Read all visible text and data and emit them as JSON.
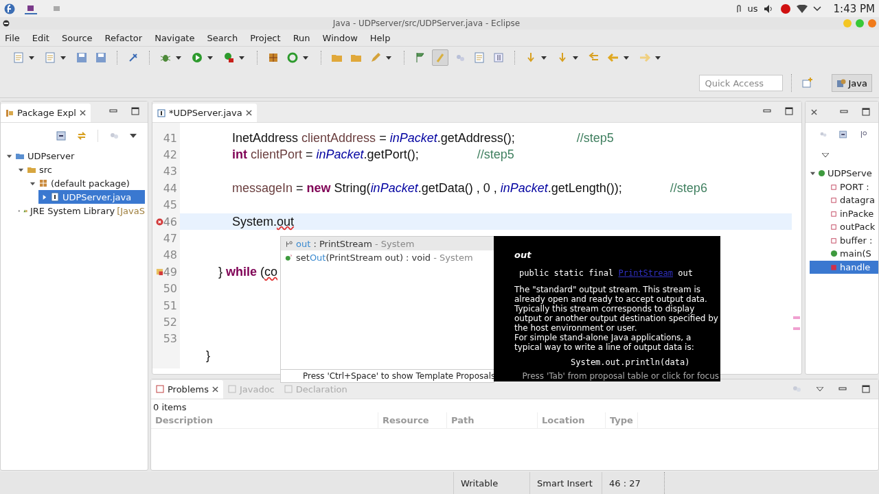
{
  "top_bar": {
    "keyboard": "us",
    "clock": "1:43 PM"
  },
  "window": {
    "title": "Java - UDPserver/src/UDPServer.java - Eclipse"
  },
  "menu": [
    "File",
    "Edit",
    "Source",
    "Refactor",
    "Navigate",
    "Search",
    "Project",
    "Run",
    "Window",
    "Help"
  ],
  "quick_access": {
    "placeholder": "Quick Access"
  },
  "perspective": {
    "label": "Java",
    "selected": true
  },
  "package_explorer": {
    "title": "Package Expl",
    "tree": [
      {
        "label": "UDPserver",
        "kind": "project",
        "expanded": true,
        "selected": false,
        "children": [
          {
            "label": "src",
            "kind": "source-folder",
            "expanded": true,
            "selected": false,
            "children": [
              {
                "label": "(default package)",
                "kind": "package",
                "expanded": true,
                "selected": false,
                "children": [
                  {
                    "label": "UDPServer.java",
                    "kind": "java-file",
                    "expanded": false,
                    "selected": true
                  }
                ]
              }
            ]
          },
          {
            "label": "JRE System Library",
            "decoration": "[JavaS",
            "kind": "library",
            "expanded": false,
            "selected": false
          }
        ]
      }
    ]
  },
  "editor": {
    "tab": {
      "label": "*UDPServer.java",
      "selected": true
    },
    "lines": [
      {
        "number": "41",
        "kind": "statement",
        "current": false,
        "tokens": [
          {
            "kind": "plain",
            "text": "InetAddress "
          },
          {
            "kind": "local",
            "text": "clientAddress"
          },
          {
            "kind": "plain",
            "text": " = "
          },
          {
            "kind": "field",
            "text": "inPacket"
          },
          {
            "kind": "plain",
            "text": ".getAddress();                  "
          },
          {
            "kind": "comment",
            "text": "//step5"
          }
        ]
      },
      {
        "number": "42",
        "kind": "statement",
        "current": false,
        "tokens": [
          {
            "kind": "keyword",
            "text": "int"
          },
          {
            "kind": "local",
            "text": " clientPort"
          },
          {
            "kind": "plain",
            "text": " = "
          },
          {
            "kind": "field",
            "text": "inPacket"
          },
          {
            "kind": "plain",
            "text": ".getPort();                 "
          },
          {
            "kind": "comment",
            "text": "//step5"
          }
        ]
      },
      {
        "number": "43",
        "current": false
      },
      {
        "number": "44",
        "kind": "statement",
        "current": false,
        "tokens": [
          {
            "kind": "local",
            "text": "messageIn"
          },
          {
            "kind": "plain",
            "text": " = "
          },
          {
            "kind": "keyword",
            "text": "new"
          },
          {
            "kind": "plain",
            "text": " String("
          },
          {
            "kind": "field",
            "text": "inPacket"
          },
          {
            "kind": "plain",
            "text": ".getData() , 0 , "
          },
          {
            "kind": "field",
            "text": "inPacket"
          },
          {
            "kind": "plain",
            "text": ".getLength());              "
          },
          {
            "kind": "comment",
            "text": "//step6"
          }
        ]
      },
      {
        "number": "45",
        "current": false
      },
      {
        "number": "46",
        "kind": "statement",
        "current": true,
        "error": true,
        "tokens": [
          {
            "kind": "plain",
            "text": "System."
          },
          {
            "kind": "error",
            "text": "out"
          }
        ]
      },
      {
        "number": "47",
        "current": false
      },
      {
        "number": "48",
        "current": false
      },
      {
        "number": "49",
        "kind": "loop-close",
        "current": false,
        "warning": true,
        "tokens": [
          {
            "kind": "plain",
            "text": "} "
          },
          {
            "kind": "keyword",
            "text": "while"
          },
          {
            "kind": "plain",
            "text": " ("
          },
          {
            "kind": "error",
            "text": "co"
          }
        ]
      },
      {
        "number": "50",
        "current": false
      },
      {
        "number": "51",
        "current": false
      },
      {
        "number": "52",
        "current": false
      },
      {
        "number": "53",
        "current": false
      },
      {
        "kind": "block-close",
        "current": false,
        "tokens": [
          {
            "kind": "plain",
            "text": "}"
          }
        ]
      }
    ]
  },
  "completion": {
    "items": [
      {
        "kind": "field",
        "match": "out",
        "rest": " : PrintStream",
        "qualifier": " - System",
        "selected": true
      },
      {
        "kind": "method",
        "prefix": "set",
        "match": "Out",
        "rest": "(PrintStream out) : void",
        "qualifier": " - System",
        "selected": false
      }
    ],
    "footer": "Press 'Ctrl+Space' to show Template Proposals"
  },
  "javadoc_popup": {
    "name": "out",
    "signature_before": "public static final ",
    "signature_link": "PrintStream",
    "signature_after": " out",
    "description": "The \"standard\" output stream. This stream is already open and ready to accept output data. Typically this stream corresponds to display output or another output destination specified by the host environment or user.",
    "description_2": "For simple stand-alone Java applications, a typical way to write a line of output data is:",
    "example": "System.out.println(data)",
    "footer": "Press 'Tab' from proposal table or click for focus"
  },
  "outline": {
    "items": [
      {
        "label": "UDPServe",
        "kind": "class",
        "selected": false,
        "children": [
          {
            "label": "PORT :",
            "kind": "constant",
            "selected": false
          },
          {
            "label": "datagra",
            "kind": "field",
            "selected": false
          },
          {
            "label": "inPacke",
            "kind": "field",
            "selected": false
          },
          {
            "label": "outPack",
            "kind": "field",
            "selected": false
          },
          {
            "label": "buffer :",
            "kind": "field",
            "selected": false
          },
          {
            "label": "main(S",
            "kind": "public-method",
            "selected": false
          },
          {
            "label": "handle",
            "kind": "private-method",
            "selected": true
          }
        ]
      }
    ]
  },
  "bottom_panel": {
    "tabs": [
      {
        "label": "Problems",
        "selected": true
      },
      {
        "label": "Javadoc",
        "selected": false
      },
      {
        "label": "Declaration",
        "selected": false
      }
    ],
    "summary": "0 items",
    "columns": [
      "Description",
      "Resource",
      "Path",
      "Location",
      "Type"
    ]
  },
  "status_bar": {
    "mode": "Writable",
    "insert": "Smart Insert",
    "position": "46 : 27"
  }
}
